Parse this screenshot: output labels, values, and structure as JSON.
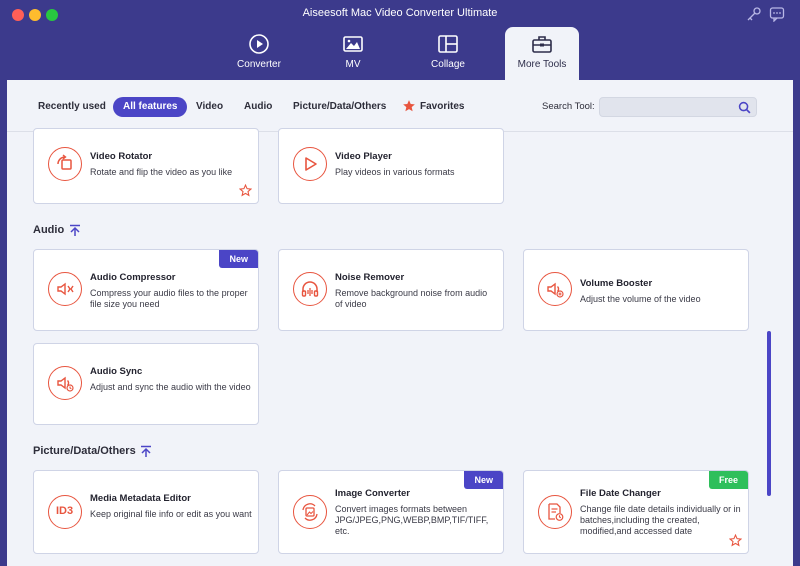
{
  "app": {
    "title": "Aiseesoft Mac Video Converter Ultimate"
  },
  "nav": {
    "tabs": [
      {
        "label": "Converter"
      },
      {
        "label": "MV"
      },
      {
        "label": "Collage"
      },
      {
        "label": "More Tools"
      }
    ]
  },
  "filter": {
    "items": [
      {
        "label": "Recently used"
      },
      {
        "label": "All features"
      },
      {
        "label": "Video"
      },
      {
        "label": "Audio"
      },
      {
        "label": "Picture/Data/Others"
      },
      {
        "label": "Favorites"
      }
    ],
    "search_label": "Search Tool:",
    "search_value": ""
  },
  "video_tools": [
    {
      "title": "Video Rotator",
      "desc": "Rotate and flip the video as you like"
    },
    {
      "title": "Video Player",
      "desc": "Play videos in various formats"
    }
  ],
  "sections": {
    "audio": "Audio",
    "picture": "Picture/Data/Others"
  },
  "audio_tools": [
    {
      "title": "Audio Compressor",
      "desc": "Compress your audio files to the proper file size you need",
      "badge": "New"
    },
    {
      "title": "Noise Remover",
      "desc": "Remove background noise from audio of video"
    },
    {
      "title": "Volume Booster",
      "desc": "Adjust the volume of the video"
    },
    {
      "title": "Audio Sync",
      "desc": "Adjust and sync the audio with the video"
    }
  ],
  "picture_tools": [
    {
      "title": "Media Metadata Editor",
      "desc": "Keep original file info or edit as you want",
      "icon_text": "ID3"
    },
    {
      "title": "Image Converter",
      "desc": "Convert images formats between JPG/JPEG,PNG,WEBP,BMP,TIF/TIFF, etc.",
      "badge": "New"
    },
    {
      "title": "File Date Changer",
      "desc": "Change file date details individually or in batches,including the created, modified,and accessed date",
      "badge": "Free"
    }
  ],
  "colors": {
    "accent": "#4b45c6",
    "icon": "#e8553f",
    "window": "#3c3a8c",
    "free": "#2ebf5b"
  }
}
